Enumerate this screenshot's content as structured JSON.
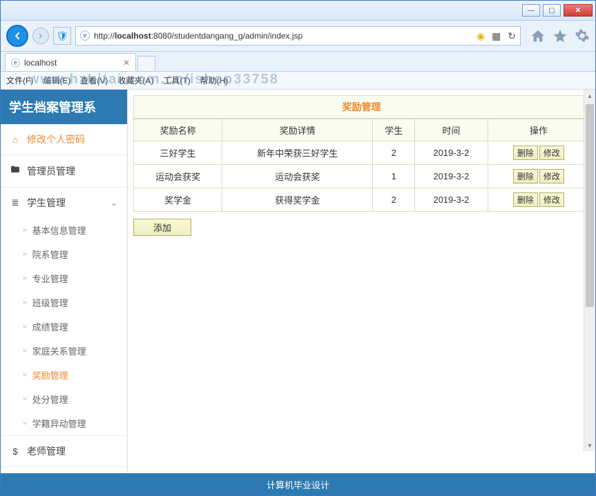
{
  "window": {
    "min": "—",
    "max": "▢",
    "close": "✕"
  },
  "address": {
    "prefix": "http://",
    "host": "localhost",
    "portpath": ":8080/studentdangang_g/admin/index.jsp"
  },
  "tab": {
    "title": "localhost"
  },
  "menubar": {
    "items": [
      "文件(F)",
      "编辑(E)",
      "查看(V)",
      "收藏夹(A)",
      "工具(T)",
      "帮助(H)"
    ],
    "watermark": "www.hzLitai.com.cn/ishop33758"
  },
  "brand": "学生档案管理系",
  "sidebar": {
    "items": [
      {
        "icon": "home",
        "label": "修改个人密码",
        "active": true
      },
      {
        "icon": "briefcase",
        "label": "管理员管理"
      },
      {
        "icon": "list",
        "label": "学生管理",
        "chev": true,
        "children": [
          "基本信息管理",
          "院系管理",
          "专业管理",
          "班级管理",
          "成绩管理",
          "家庭关系管理",
          "奖励管理",
          "处分管理",
          "学籍异动管理"
        ],
        "activeChild": "奖励管理"
      },
      {
        "icon": "dollar",
        "label": "老师管理"
      }
    ]
  },
  "panel": {
    "title": "奖励管理",
    "columns": [
      "奖励名称",
      "奖励详情",
      "学生",
      "时间",
      "操作"
    ],
    "rows": [
      {
        "name": "三好学生",
        "detail": "新年中荣获三好学生",
        "student": "2",
        "date": "2019-3-2"
      },
      {
        "name": "运动会获奖",
        "detail": "运动会获奖",
        "student": "1",
        "date": "2019-3-2"
      },
      {
        "name": "奖学金",
        "detail": "获得奖学金",
        "student": "2",
        "date": "2019-3-2"
      }
    ],
    "op_delete": "删除",
    "op_edit": "修改",
    "add": "添加"
  },
  "footer": "计算机毕业设计"
}
